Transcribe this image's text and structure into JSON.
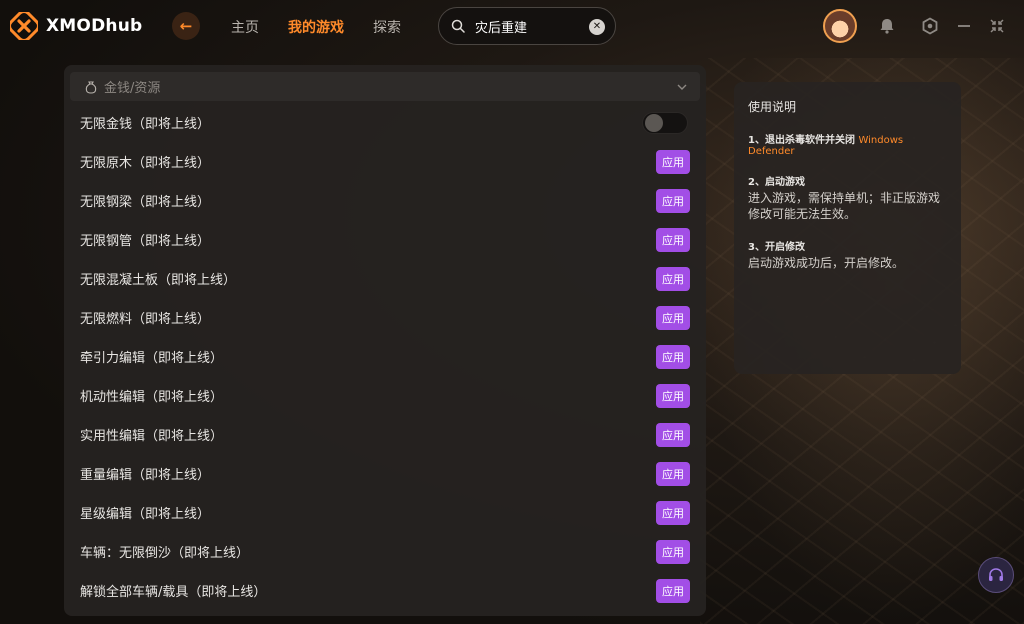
{
  "app": {
    "logo_text": "XMODhub"
  },
  "nav": {
    "tabs": [
      {
        "label": "主页",
        "active": false
      },
      {
        "label": "我的游戏",
        "active": true
      },
      {
        "label": "探索",
        "active": false
      }
    ]
  },
  "search": {
    "value": "灾后重建",
    "icon": "search-icon",
    "clear_icon": "close-icon"
  },
  "window_controls": [
    "notification-icon",
    "settings-hex-icon",
    "minimize-icon",
    "shrink-icon"
  ],
  "category": {
    "label": "金钱/资源",
    "icon": "money-bag-icon",
    "expanded": true
  },
  "mods": [
    {
      "label": "无限金钱（即将上线）",
      "control": "toggle",
      "enabled": false
    },
    {
      "label": "无限原木（即将上线）",
      "control": "button",
      "button_label": "应用"
    },
    {
      "label": "无限钢梁（即将上线）",
      "control": "button",
      "button_label": "应用"
    },
    {
      "label": "无限钢管（即将上线）",
      "control": "button",
      "button_label": "应用"
    },
    {
      "label": "无限混凝土板（即将上线）",
      "control": "button",
      "button_label": "应用"
    },
    {
      "label": "无限燃料（即将上线）",
      "control": "button",
      "button_label": "应用"
    },
    {
      "label": "牵引力编辑（即将上线）",
      "control": "button",
      "button_label": "应用"
    },
    {
      "label": "机动性编辑（即将上线）",
      "control": "button",
      "button_label": "应用"
    },
    {
      "label": "实用性编辑（即将上线）",
      "control": "button",
      "button_label": "应用"
    },
    {
      "label": "重量编辑（即将上线）",
      "control": "button",
      "button_label": "应用"
    },
    {
      "label": "星级编辑（即将上线）",
      "control": "button",
      "button_label": "应用"
    },
    {
      "label": "车辆：无限倒沙（即将上线）",
      "control": "button",
      "button_label": "应用"
    },
    {
      "label": "解锁全部车辆/载具（即将上线）",
      "control": "button",
      "button_label": "应用"
    }
  ],
  "instructions": {
    "title": "使用说明",
    "step1_title": "1、退出杀毒软件并关闭",
    "step1_highlight": "Windows Defender",
    "step2_title": "2、启动游戏",
    "step2_body": "进入游戏，需保持单机；非正版游戏修改可能无法生效。",
    "step3_title": "3、开启修改",
    "step3_body": "启动游戏成功后，开启修改。"
  },
  "colors": {
    "accent": "#ff8a2a",
    "apply_button": "#a24ee6",
    "panel": "#252220"
  }
}
